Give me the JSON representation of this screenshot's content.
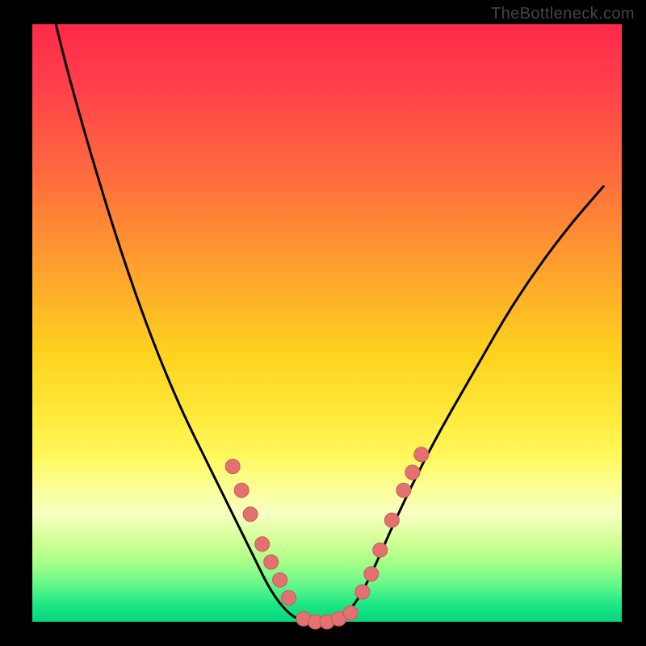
{
  "watermark": "TheBottleneck.com",
  "colors": {
    "frame": "#000000",
    "curve": "#000000",
    "dot_fill": "#e4706f",
    "dot_stroke": "#c95a5a",
    "gradient_top": "#ff2a4a",
    "gradient_bottom": "#05d67c"
  },
  "chart_data": {
    "type": "line",
    "title": "",
    "xlabel": "",
    "ylabel": "",
    "xlim": [
      0,
      100
    ],
    "ylim": [
      0,
      100
    ],
    "grid": false,
    "legend": false,
    "series": [
      {
        "name": "bottleneck-curve",
        "x": [
          4,
          6,
          10,
          15,
          20,
          25,
          30,
          34,
          36,
          38,
          40,
          42,
          44,
          46,
          48,
          50,
          52,
          54,
          56,
          58,
          62,
          68,
          75,
          82,
          90,
          97
        ],
        "y": [
          100,
          92,
          78,
          62,
          48,
          36,
          26,
          18,
          14,
          10,
          6,
          3,
          1,
          0,
          0,
          0,
          1,
          2,
          5,
          9,
          18,
          30,
          42,
          54,
          65,
          73
        ]
      }
    ],
    "markers": [
      {
        "name": "left-cluster",
        "points": [
          {
            "x": 34,
            "y": 26
          },
          {
            "x": 35.5,
            "y": 22
          },
          {
            "x": 37,
            "y": 18
          },
          {
            "x": 39,
            "y": 13
          },
          {
            "x": 40.5,
            "y": 10
          },
          {
            "x": 42,
            "y": 7
          },
          {
            "x": 43.5,
            "y": 4
          }
        ]
      },
      {
        "name": "valley-cluster",
        "points": [
          {
            "x": 46,
            "y": 0.5
          },
          {
            "x": 48,
            "y": 0
          },
          {
            "x": 50,
            "y": 0
          },
          {
            "x": 52,
            "y": 0.5
          },
          {
            "x": 54,
            "y": 1.5
          }
        ]
      },
      {
        "name": "right-cluster",
        "points": [
          {
            "x": 56,
            "y": 5
          },
          {
            "x": 57.5,
            "y": 8
          },
          {
            "x": 59,
            "y": 12
          },
          {
            "x": 61,
            "y": 17
          },
          {
            "x": 63,
            "y": 22
          },
          {
            "x": 64.5,
            "y": 25
          },
          {
            "x": 66,
            "y": 28
          }
        ]
      }
    ]
  }
}
